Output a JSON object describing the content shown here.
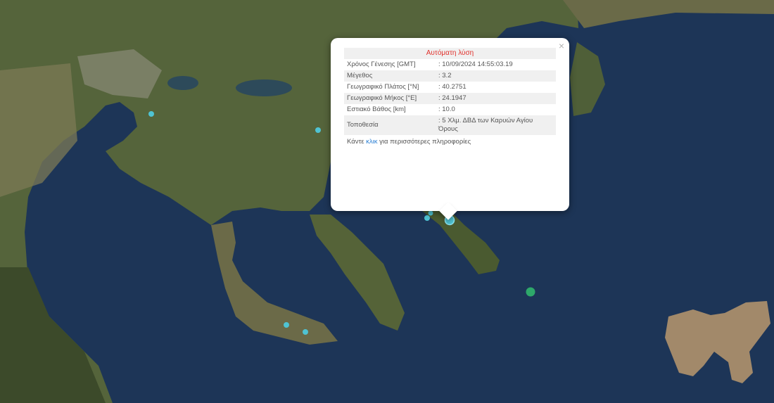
{
  "popup": {
    "title": "Αυτόματη λύση",
    "close_glyph": "×",
    "rows": [
      {
        "label": "Χρόνος Γένεσης [GMT]",
        "value": ": 10/09/2024 14:55:03.19"
      },
      {
        "label": "Μέγεθος",
        "value": ": 3.2"
      },
      {
        "label": "Γεωγραφικό Πλάτος [°N]",
        "value": ": 40.2751"
      },
      {
        "label": "Γεωγραφικό Μήκος [°E]",
        "value": ": 24.1947"
      },
      {
        "label": "Εστιακό Βάθος [km]",
        "value": ": 10.0"
      },
      {
        "label": "Τοποθεσία",
        "value": ": 5 Χλμ. ΔΒΔ των Καρυών Αγίου Όρους"
      }
    ],
    "more_prefix": "Κάντε ",
    "more_link": "κλικ",
    "more_suffix": " για περισσότερες πληροφορίες"
  },
  "colors": {
    "sea": "#1d3557",
    "land": "#4a5a35",
    "marker": "#4fc3d3",
    "marker_large": "#2ea86a",
    "title_red": "#e0312c",
    "link_blue": "#2a7fd4"
  }
}
